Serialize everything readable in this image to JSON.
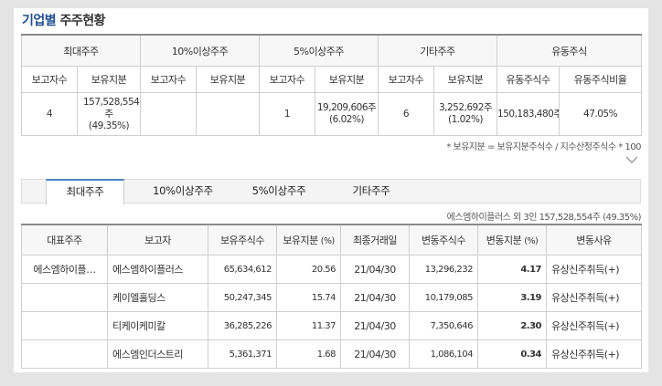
{
  "title": {
    "main": "기업별",
    "sub": "주주현황"
  },
  "summary": {
    "groups": [
      "최대주주",
      "10%이상주주",
      "5%이상주주",
      "기타주주",
      "유동주식"
    ],
    "subheaders": [
      "보고자수",
      "보유지분",
      "보고자수",
      "보유지분",
      "보고자수",
      "보유지분",
      "보고자수",
      "보유지분",
      "유동주식수",
      "유동주식비율"
    ],
    "values": {
      "largest_count": "4",
      "largest_shares": "157,528,554주",
      "largest_pct": "(49.35%)",
      "ten_count": "",
      "ten_shares": "",
      "five_count": "1",
      "five_shares": "19,209,606주",
      "five_pct": "(6.02%)",
      "other_count": "6",
      "other_shares": "3,252,692주",
      "other_pct": "(1.02%)",
      "float_shares": "150,183,480주",
      "float_pct": "47.05%"
    }
  },
  "note": "* 보유지분 = 보유지분주식수 / 지수산정주식수 * 100",
  "tabs": [
    "최대주주",
    "10%이상주주",
    "5%이상주주",
    "기타주주"
  ],
  "tab_info": "에스엠하이플러스 외 3인 157,528,554주 (49.35%)",
  "detail": {
    "headers": [
      "대표주주",
      "보고자",
      "보유주식수",
      "보유지분",
      "(%)",
      "최종거래일",
      "변동주식수",
      "변동지분",
      "(%)",
      "변동사유"
    ],
    "rows": [
      {
        "rep": "에스엠하이플…",
        "reporter": "에스엠하이플러스",
        "shares": "65,634,612",
        "pct": "20.56",
        "date": "21/04/30",
        "chg_shares": "13,296,232",
        "chg_pct": "4.17",
        "reason": "유상신주취득(+)"
      },
      {
        "rep": "",
        "reporter": "케이엘홀딩스",
        "shares": "50,247,345",
        "pct": "15.74",
        "date": "21/04/30",
        "chg_shares": "10,179,085",
        "chg_pct": "3.19",
        "reason": "유상신주취득(+)"
      },
      {
        "rep": "",
        "reporter": "티케이케미칼",
        "shares": "36,285,226",
        "pct": "11.37",
        "date": "21/04/30",
        "chg_shares": "7,350,646",
        "chg_pct": "2.30",
        "reason": "유상신주취득(+)"
      },
      {
        "rep": "",
        "reporter": "에스엠인더스트리",
        "shares": "5,361,371",
        "pct": "1.68",
        "date": "21/04/30",
        "chg_shares": "1,086,104",
        "chg_pct": "0.34",
        "reason": "유상신주취득(+)"
      }
    ]
  }
}
